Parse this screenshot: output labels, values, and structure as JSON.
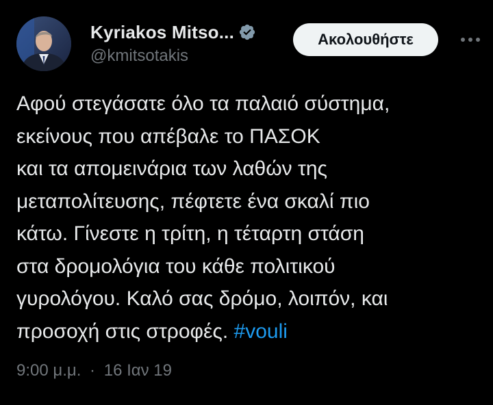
{
  "author": {
    "display_name": "Kyriakos Mitso...",
    "handle": "@kmitsotakis",
    "verified_icon": "verified-badge-icon",
    "avatar": "avatar-photo"
  },
  "header": {
    "follow_label": "Ακολουθήστε",
    "more_icon": "more-horizontal-icon"
  },
  "tweet": {
    "lines": [
      "Αφού στεγάσατε όλο τα παλαιό σύστημα,",
      "εκείνους που απέβαλε το ΠΑΣΟΚ",
      "και τα απομεινάρια των λαθών της",
      "μεταπολίτευσης, πέφτετε ένα σκαλί πιο",
      "κάτω. Γίνεστε η τρίτη, η τέταρτη στάση",
      "στα δρομολόγια του κάθε πολιτικού",
      "γυρολόγου. Καλό σας δρόμο, λοιπόν, και"
    ],
    "last_line_text": "προσοχή στις στροφές. ",
    "hashtag": "#vouli"
  },
  "meta": {
    "time": "9:00 μ.μ.",
    "separator": "·",
    "date": "16 Ιαν 19"
  },
  "colors": {
    "background": "#000000",
    "text": "#e7e9ea",
    "muted": "#71767b",
    "link": "#1d9bf0",
    "button_bg": "#eff3f4"
  }
}
